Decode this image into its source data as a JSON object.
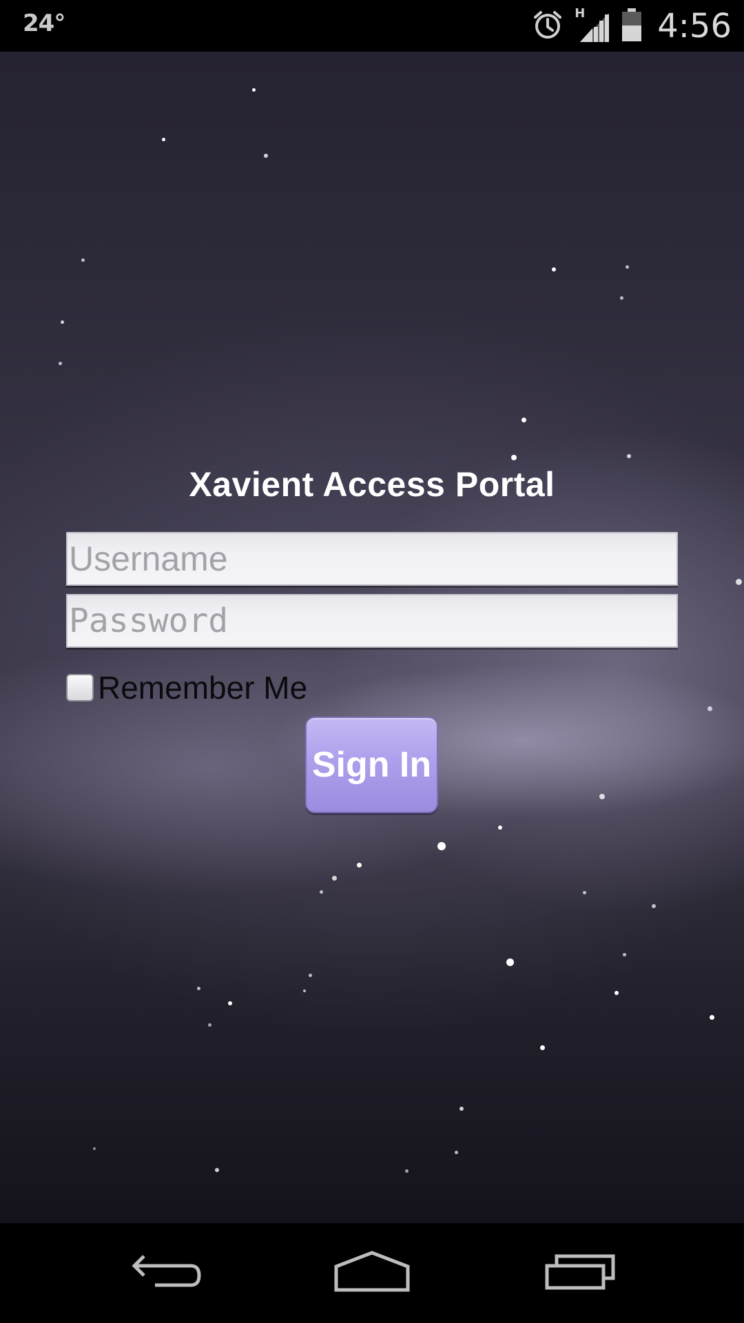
{
  "status_bar": {
    "temperature": "24°",
    "network_type": "H",
    "time": "4:56",
    "icons": [
      "alarm-icon",
      "signal-icon",
      "battery-icon"
    ]
  },
  "login": {
    "title": "Xavient Access Portal",
    "username_placeholder": "Username",
    "username_value": "",
    "password_placeholder": "Password",
    "password_value": "",
    "remember_label": "Remember Me",
    "remember_checked": false,
    "signin_label": "Sign In"
  },
  "nav_bar": {
    "icons": [
      "back-icon",
      "home-icon",
      "recent-apps-icon"
    ]
  },
  "colors": {
    "button_accent": "#ae9fec",
    "title_text": "#ffffff",
    "field_bg": "#f2f1f5"
  }
}
